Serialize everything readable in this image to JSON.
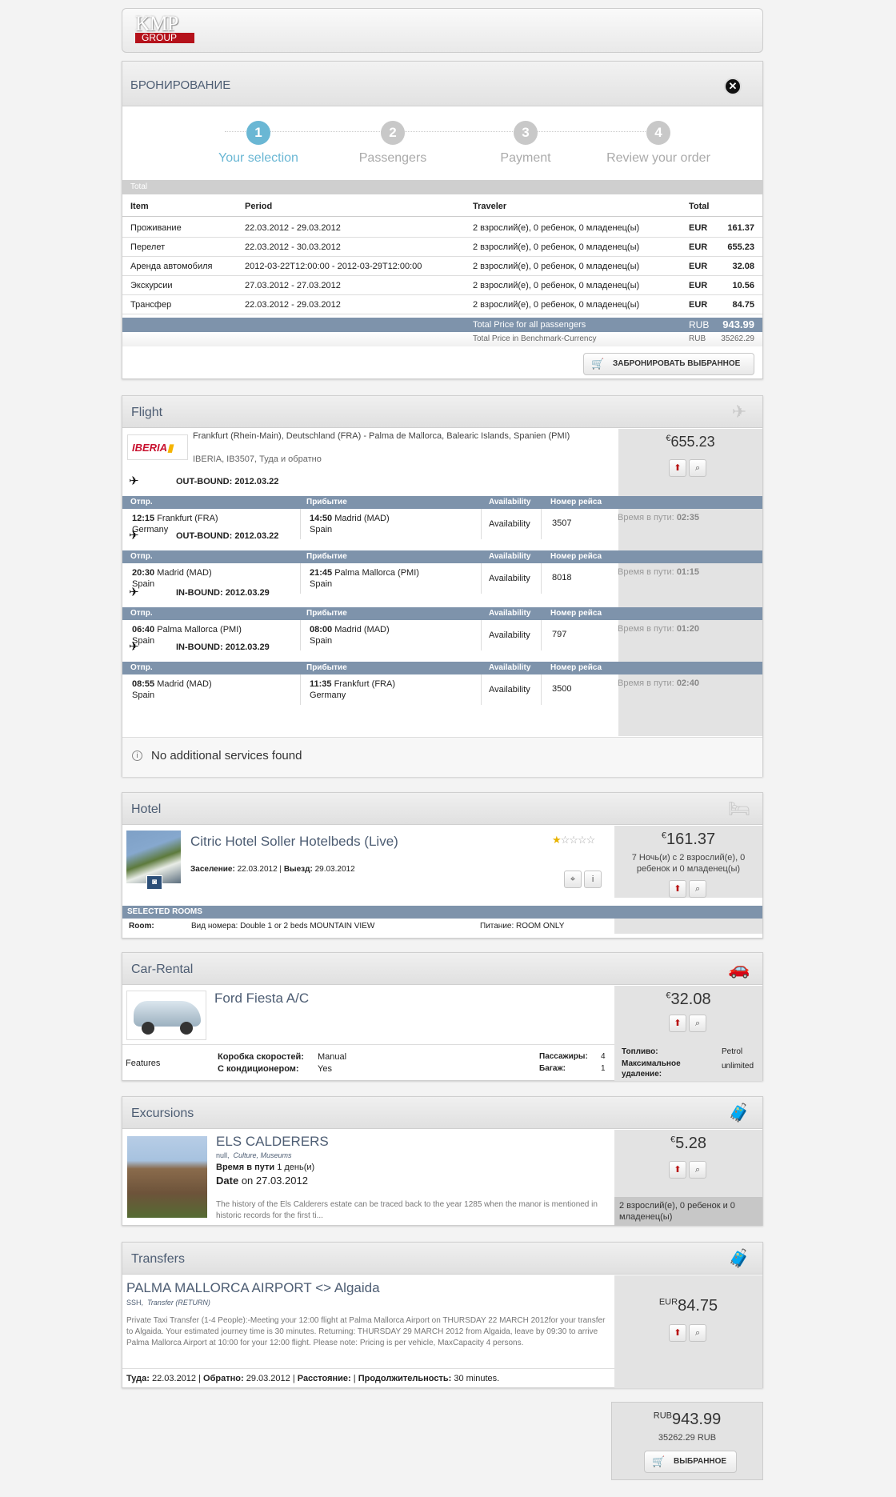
{
  "header": {
    "logo_top": "KMP",
    "logo_bottom": "GROUP"
  },
  "booking": {
    "title": "БРОНИРОВАНИЕ",
    "steps": [
      {
        "num": "1",
        "label": "Your selection"
      },
      {
        "num": "2",
        "label": "Passengers"
      },
      {
        "num": "3",
        "label": "Payment"
      },
      {
        "num": "4",
        "label": "Review your order"
      }
    ],
    "total_label": "Total",
    "columns": {
      "item": "Item",
      "period": "Period",
      "traveler": "Traveler",
      "total": "Total"
    },
    "rows": [
      {
        "item": "Проживание",
        "period": "22.03.2012 - 29.03.2012",
        "traveler": "2 взрослий(е), 0 ребенок, 0 младенец(ы)",
        "cur": "EUR",
        "amount": "161.37"
      },
      {
        "item": "Перелет",
        "period": "22.03.2012 - 30.03.2012",
        "traveler": "2 взрослий(е), 0 ребенок, 0 младенец(ы)",
        "cur": "EUR",
        "amount": "655.23"
      },
      {
        "item": "Аренда автомобиля",
        "period": "2012-03-22T12:00:00 - 2012-03-29T12:00:00",
        "traveler": "2 взрослий(е), 0 ребенок, 0 младенец(ы)",
        "cur": "EUR",
        "amount": "32.08"
      },
      {
        "item": "Экскурсии",
        "period": "27.03.2012 - 27.03.2012",
        "traveler": "2 взрослий(е), 0 ребенок, 0 младенец(ы)",
        "cur": "EUR",
        "amount": "10.56"
      },
      {
        "item": "Трансфер",
        "period": "22.03.2012 - 29.03.2012",
        "traveler": "2 взрослий(е), 0 ребенок, 0 младенец(ы)",
        "cur": "EUR",
        "amount": "84.75"
      }
    ],
    "total_all_label": "Total Price for all passengers",
    "total_all_cur": "RUB",
    "total_all_amount": "943.99",
    "bench_label": "Total Price in Benchmark-Currency",
    "bench_cur": "RUB",
    "bench_amount": "35262.29",
    "book_button": "ЗАБРОНИРОВАТЬ ВЫБРАННОЕ"
  },
  "flight": {
    "title": "Flight",
    "route": "Frankfurt (Rhein-Main), Deutschland (FRA) - Palma de Mallorca, Balearic Islands, Spanien (PMI)",
    "airline_line": "IBERIA, IB3507, Туда и обратно",
    "airline_logo": "IBERIA",
    "currency_symbol": "€",
    "price": "655.23",
    "cols": {
      "dep": "Отпр.",
      "arr": "Прибытие",
      "avail": "Availability",
      "flight_no": "Номер рейса"
    },
    "duration_label": "Время в пути:",
    "legs": [
      {
        "bound": "OUT-BOUND: 2012.03.22",
        "dep_time": "12:15",
        "dep_place": "Frankfurt (FRA)",
        "dep_country": "Germany",
        "arr_time": "14:50",
        "arr_place": "Madrid (MAD)",
        "arr_country": "Spain",
        "avail": "Availability",
        "flight_no": "3507",
        "duration": "02:35"
      },
      {
        "bound": "OUT-BOUND: 2012.03.22",
        "dep_time": "20:30",
        "dep_place": "Madrid (MAD)",
        "dep_country": "Spain",
        "arr_time": "21:45",
        "arr_place": "Palma Mallorca (PMI)",
        "arr_country": "Spain",
        "avail": "Availability",
        "flight_no": "8018",
        "duration": "01:15"
      },
      {
        "bound": "IN-BOUND: 2012.03.29",
        "dep_time": "06:40",
        "dep_place": "Palma Mallorca (PMI)",
        "dep_country": "Spain",
        "arr_time": "08:00",
        "arr_place": "Madrid (MAD)",
        "arr_country": "Spain",
        "avail": "Availability",
        "flight_no": "797",
        "duration": "01:20"
      },
      {
        "bound": "IN-BOUND: 2012.03.29",
        "dep_time": "08:55",
        "dep_place": "Madrid (MAD)",
        "dep_country": "Spain",
        "arr_time": "11:35",
        "arr_place": "Frankfurt (FRA)",
        "arr_country": "Germany",
        "avail": "Availability",
        "flight_no": "3500",
        "duration": "02:40"
      }
    ],
    "no_services": "No additional services found"
  },
  "hotel": {
    "title": "Hotel",
    "name": "Citric Hotel Soller Hotelbeds (Live)",
    "rating": 1,
    "checkin_label": "Заселение:",
    "checkin": "22.03.2012",
    "checkout_label": "Выезд:",
    "checkout": "29.03.2012",
    "currency_symbol": "€",
    "price": "161.37",
    "nights_text": "7 Ночь(и) с 2 взрослий(е), 0 ребенок и 0 младенец(ы)",
    "selected_rooms": "SELECTED ROOMS",
    "room_label": "Room:",
    "room_type": "Вид номера: Double 1 or 2 beds MOUNTAIN VIEW",
    "board": "Питание: ROOM ONLY"
  },
  "car": {
    "title": "Car-Rental",
    "name": "Ford Fiesta A/C",
    "currency_symbol": "€",
    "price": "32.08",
    "features_label": "Features",
    "gearbox_label": "Коробка скоростей:",
    "gearbox": "Manual",
    "ac_label": "С кондиционером:",
    "ac": "Yes",
    "pax_label": "Пассажиры:",
    "pax": "4",
    "bags_label": "Багаж:",
    "bags": "1",
    "fuel_label": "Топливо:",
    "fuel": "Petrol",
    "mileage_label": "Максимальное удаление:",
    "mileage": "unlimited"
  },
  "excursion": {
    "title": "Excursions",
    "name": "ELS CALDERERS",
    "sub1": "null,",
    "sub2": "Culture, Museums",
    "duration_label": "Время в пути",
    "duration": "1 день(и)",
    "date_label": "Date",
    "date": "on 27.03.2012",
    "desc": "The history of the Els Calderers estate can be traced back to the year 1285 when the manor is mentioned in historic records for the first ti...",
    "currency_symbol": "€",
    "price": "5.28",
    "travelers": "2 взрослий(е), 0 ребенок и 0 младенец(ы)"
  },
  "transfer": {
    "title": "Transfers",
    "name": "PALMA MALLORCA AIRPORT <> Algaida",
    "sub1": "SSH,",
    "sub2": "Transfer (RETURN)",
    "desc": "Private Taxi Transfer (1-4 People):-Meeting your 12:00 flight at Palma Mallorca Airport on THURSDAY 22 MARCH 2012for your transfer to Algaida. Your estimated journey time is 30 minutes. Returning: THURSDAY 29 MARCH 2012 from Algaida, leave by 09:30 to arrive Palma Mallorca Airport at 10:00 for your 12:00 flight. Please note: Pricing is per vehicle, MaxCapacity 4 persons.",
    "there_label": "Туда:",
    "there": "22.03.2012",
    "back_label": "Обратно:",
    "back": "29.03.2012",
    "dist_label": "Расстояние:",
    "dur_label": "Продолжительность:",
    "dur": "30 minutes.",
    "currency": "EUR",
    "price": "84.75"
  },
  "summary": {
    "currency": "RUB",
    "total": "943.99",
    "bench": "35262.29 RUB",
    "button": "ВЫБРАННОЕ"
  },
  "colors": {
    "step_active": "#6ab7d4",
    "step_inactive": "#c8c8c8",
    "bar": "#7e93ab",
    "title": "#4d5d73",
    "logo_red": "#b5121b"
  }
}
